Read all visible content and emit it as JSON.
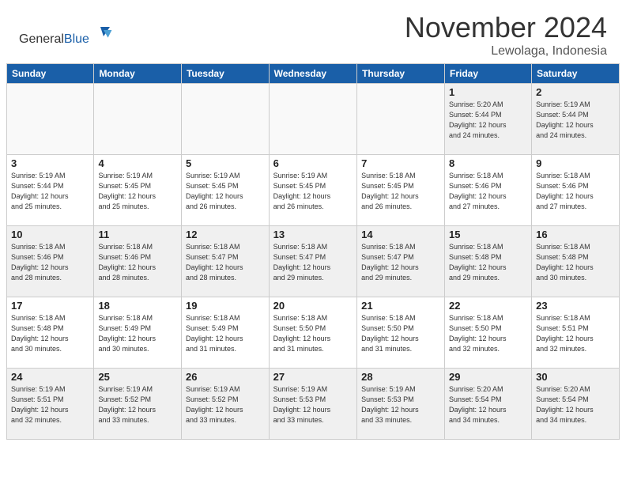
{
  "header": {
    "logo_general": "General",
    "logo_blue": "Blue",
    "month_title": "November 2024",
    "location": "Lewolaga, Indonesia"
  },
  "calendar": {
    "days_of_week": [
      "Sunday",
      "Monday",
      "Tuesday",
      "Wednesday",
      "Thursday",
      "Friday",
      "Saturday"
    ],
    "weeks": [
      [
        {
          "day": "",
          "info": ""
        },
        {
          "day": "",
          "info": ""
        },
        {
          "day": "",
          "info": ""
        },
        {
          "day": "",
          "info": ""
        },
        {
          "day": "",
          "info": ""
        },
        {
          "day": "1",
          "info": "Sunrise: 5:20 AM\nSunset: 5:44 PM\nDaylight: 12 hours\nand 24 minutes."
        },
        {
          "day": "2",
          "info": "Sunrise: 5:19 AM\nSunset: 5:44 PM\nDaylight: 12 hours\nand 24 minutes."
        }
      ],
      [
        {
          "day": "3",
          "info": "Sunrise: 5:19 AM\nSunset: 5:44 PM\nDaylight: 12 hours\nand 25 minutes."
        },
        {
          "day": "4",
          "info": "Sunrise: 5:19 AM\nSunset: 5:45 PM\nDaylight: 12 hours\nand 25 minutes."
        },
        {
          "day": "5",
          "info": "Sunrise: 5:19 AM\nSunset: 5:45 PM\nDaylight: 12 hours\nand 26 minutes."
        },
        {
          "day": "6",
          "info": "Sunrise: 5:19 AM\nSunset: 5:45 PM\nDaylight: 12 hours\nand 26 minutes."
        },
        {
          "day": "7",
          "info": "Sunrise: 5:18 AM\nSunset: 5:45 PM\nDaylight: 12 hours\nand 26 minutes."
        },
        {
          "day": "8",
          "info": "Sunrise: 5:18 AM\nSunset: 5:46 PM\nDaylight: 12 hours\nand 27 minutes."
        },
        {
          "day": "9",
          "info": "Sunrise: 5:18 AM\nSunset: 5:46 PM\nDaylight: 12 hours\nand 27 minutes."
        }
      ],
      [
        {
          "day": "10",
          "info": "Sunrise: 5:18 AM\nSunset: 5:46 PM\nDaylight: 12 hours\nand 28 minutes."
        },
        {
          "day": "11",
          "info": "Sunrise: 5:18 AM\nSunset: 5:46 PM\nDaylight: 12 hours\nand 28 minutes."
        },
        {
          "day": "12",
          "info": "Sunrise: 5:18 AM\nSunset: 5:47 PM\nDaylight: 12 hours\nand 28 minutes."
        },
        {
          "day": "13",
          "info": "Sunrise: 5:18 AM\nSunset: 5:47 PM\nDaylight: 12 hours\nand 29 minutes."
        },
        {
          "day": "14",
          "info": "Sunrise: 5:18 AM\nSunset: 5:47 PM\nDaylight: 12 hours\nand 29 minutes."
        },
        {
          "day": "15",
          "info": "Sunrise: 5:18 AM\nSunset: 5:48 PM\nDaylight: 12 hours\nand 29 minutes."
        },
        {
          "day": "16",
          "info": "Sunrise: 5:18 AM\nSunset: 5:48 PM\nDaylight: 12 hours\nand 30 minutes."
        }
      ],
      [
        {
          "day": "17",
          "info": "Sunrise: 5:18 AM\nSunset: 5:48 PM\nDaylight: 12 hours\nand 30 minutes."
        },
        {
          "day": "18",
          "info": "Sunrise: 5:18 AM\nSunset: 5:49 PM\nDaylight: 12 hours\nand 30 minutes."
        },
        {
          "day": "19",
          "info": "Sunrise: 5:18 AM\nSunset: 5:49 PM\nDaylight: 12 hours\nand 31 minutes."
        },
        {
          "day": "20",
          "info": "Sunrise: 5:18 AM\nSunset: 5:50 PM\nDaylight: 12 hours\nand 31 minutes."
        },
        {
          "day": "21",
          "info": "Sunrise: 5:18 AM\nSunset: 5:50 PM\nDaylight: 12 hours\nand 31 minutes."
        },
        {
          "day": "22",
          "info": "Sunrise: 5:18 AM\nSunset: 5:50 PM\nDaylight: 12 hours\nand 32 minutes."
        },
        {
          "day": "23",
          "info": "Sunrise: 5:18 AM\nSunset: 5:51 PM\nDaylight: 12 hours\nand 32 minutes."
        }
      ],
      [
        {
          "day": "24",
          "info": "Sunrise: 5:19 AM\nSunset: 5:51 PM\nDaylight: 12 hours\nand 32 minutes."
        },
        {
          "day": "25",
          "info": "Sunrise: 5:19 AM\nSunset: 5:52 PM\nDaylight: 12 hours\nand 33 minutes."
        },
        {
          "day": "26",
          "info": "Sunrise: 5:19 AM\nSunset: 5:52 PM\nDaylight: 12 hours\nand 33 minutes."
        },
        {
          "day": "27",
          "info": "Sunrise: 5:19 AM\nSunset: 5:53 PM\nDaylight: 12 hours\nand 33 minutes."
        },
        {
          "day": "28",
          "info": "Sunrise: 5:19 AM\nSunset: 5:53 PM\nDaylight: 12 hours\nand 33 minutes."
        },
        {
          "day": "29",
          "info": "Sunrise: 5:20 AM\nSunset: 5:54 PM\nDaylight: 12 hours\nand 34 minutes."
        },
        {
          "day": "30",
          "info": "Sunrise: 5:20 AM\nSunset: 5:54 PM\nDaylight: 12 hours\nand 34 minutes."
        }
      ]
    ]
  }
}
